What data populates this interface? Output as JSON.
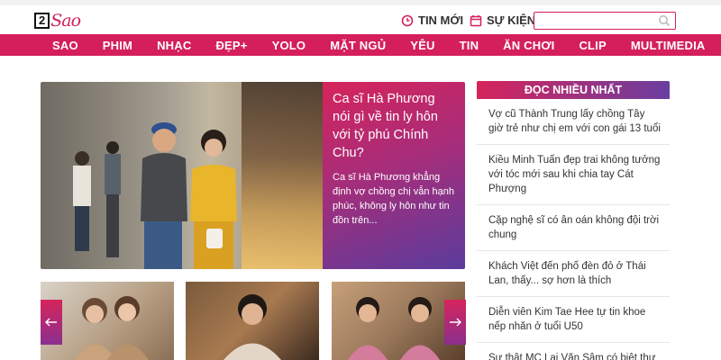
{
  "header": {
    "logo_num": "2",
    "logo_word": "Sao",
    "quick_links": [
      {
        "label": "TIN MỚI",
        "icon": "clock-icon"
      },
      {
        "label": "SỰ KIỆN",
        "icon": "calendar-icon"
      }
    ],
    "search_placeholder": ""
  },
  "nav": {
    "items": [
      "SAO",
      "PHIM",
      "NHẠC",
      "ĐẸP+",
      "YOLO",
      "MẶT NGỦ",
      "YÊU",
      "TIN",
      "ĂN CHƠI",
      "CLIP",
      "MULTIMEDIA"
    ]
  },
  "hero": {
    "title": "Ca sĩ Hà Phương nói gì về tin ly hôn với tỷ phú Chính Chu?",
    "description": "Ca sĩ Hà Phương khẳng định vợ chồng chị vẫn hạnh phúc, không ly hôn như tin đồn trên..."
  },
  "sidebar": {
    "heading": "ĐỌC NHIỀU NHẤT",
    "items": [
      "Vợ cũ Thành Trung lấy chồng Tây giờ trẻ như chị em với con gái 13 tuổi",
      "Kiều Minh Tuấn đẹp trai không tưởng với tóc mới sau khi chia tay Cát Phượng",
      "Cặp nghệ sĩ có ân oán không đội trời chung",
      "Khách Việt đến phố đèn đỏ ở Thái Lan, thấy... sợ hơn là thích",
      "Diễn viên Kim Tae Hee tự tin khoe nếp nhăn ở tuổi U50",
      "Sự thật MC Lại Văn Sâm có biệt thự"
    ]
  },
  "colors": {
    "brand": "#d41f5c",
    "gradient_end": "#6a3ea0"
  }
}
